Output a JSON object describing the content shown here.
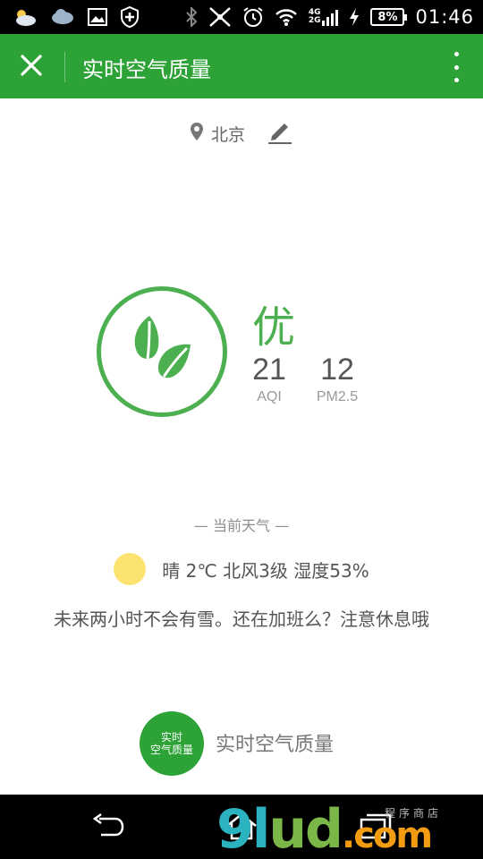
{
  "status_bar": {
    "time": "01:46",
    "battery": "8%",
    "network_top": "4G",
    "network_bottom": "2G",
    "icons": [
      "weather-cloud-icon",
      "cloud-icon",
      "image-icon",
      "shield-plus-icon",
      "bluetooth-icon",
      "mute-icon",
      "alarm-icon",
      "wifi-icon",
      "signal-icon",
      "charging-icon",
      "battery-icon"
    ]
  },
  "header": {
    "title": "实时空气质量",
    "close_icon": "close-icon",
    "more_icon": "more-vert-icon"
  },
  "location": {
    "city": "北京",
    "pin_icon": "location-pin-icon",
    "edit_icon": "edit-pencil-icon"
  },
  "air_quality": {
    "level": "优",
    "aqi_value": "21",
    "aqi_label": "AQI",
    "pm25_value": "12",
    "pm25_label": "PM2.5",
    "icon": "leaf-icon",
    "color": "#4caf50"
  },
  "weather": {
    "heading": "— 当前天气 —",
    "summary": "晴 2℃ 北风3级 湿度53%",
    "icon": "sun-icon",
    "forecast": "未来两小时不会有雪。还在加班么？注意休息哦"
  },
  "brand": {
    "badge_line1": "实时",
    "badge_line2": "空气质量",
    "name": "实时空气质量",
    "color": "#2da337"
  },
  "nav_bar": {
    "icons": [
      "back-icon",
      "home-icon",
      "recents-icon"
    ]
  },
  "watermark": {
    "part1": "9",
    "part2": "l",
    "part3": "u",
    "part4": "d",
    "part5": ".com",
    "sub": "程序商店"
  }
}
